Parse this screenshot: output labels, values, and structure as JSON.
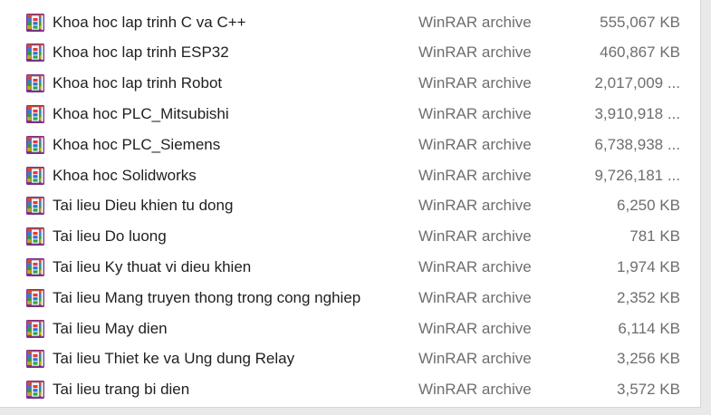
{
  "files": [
    {
      "name": "Khoa hoc lap trinh C va C++",
      "type": "WinRAR archive",
      "size": "555,067 KB",
      "icon": "winrar-archive-icon"
    },
    {
      "name": "Khoa hoc lap trinh ESP32",
      "type": "WinRAR archive",
      "size": "460,867 KB",
      "icon": "winrar-archive-icon"
    },
    {
      "name": "Khoa hoc lap trinh Robot",
      "type": "WinRAR archive",
      "size": "2,017,009 ...",
      "icon": "winrar-archive-icon"
    },
    {
      "name": "Khoa hoc PLC_Mitsubishi",
      "type": "WinRAR archive",
      "size": "3,910,918 ...",
      "icon": "winrar-archive-icon"
    },
    {
      "name": "Khoa hoc PLC_Siemens",
      "type": "WinRAR archive",
      "size": "6,738,938 ...",
      "icon": "winrar-archive-icon"
    },
    {
      "name": "Khoa hoc Solidworks",
      "type": "WinRAR archive",
      "size": "9,726,181 ...",
      "icon": "winrar-archive-icon"
    },
    {
      "name": "Tai lieu Dieu khien tu dong",
      "type": "WinRAR archive",
      "size": "6,250 KB",
      "icon": "winrar-archive-icon"
    },
    {
      "name": "Tai lieu Do luong",
      "type": "WinRAR archive",
      "size": "781 KB",
      "icon": "winrar-archive-icon"
    },
    {
      "name": "Tai lieu Ky thuat vi dieu khien",
      "type": "WinRAR archive",
      "size": "1,974 KB",
      "icon": "winrar-archive-icon"
    },
    {
      "name": "Tai lieu Mang truyen thong trong cong nghiep",
      "type": "WinRAR archive",
      "size": "2,352 KB",
      "icon": "winrar-archive-icon"
    },
    {
      "name": "Tai lieu May dien",
      "type": "WinRAR archive",
      "size": "6,114 KB",
      "icon": "winrar-archive-icon"
    },
    {
      "name": "Tai lieu Thiet ke va Ung dung Relay",
      "type": "WinRAR archive",
      "size": "3,256 KB",
      "icon": "winrar-archive-icon"
    },
    {
      "name": "Tai lieu trang bi dien",
      "type": "WinRAR archive",
      "size": "3,572 KB",
      "icon": "winrar-archive-icon"
    }
  ],
  "colors": {
    "text": "#1f1f1f",
    "secondary_text": "#6e6e6e",
    "background": "#ffffff"
  }
}
